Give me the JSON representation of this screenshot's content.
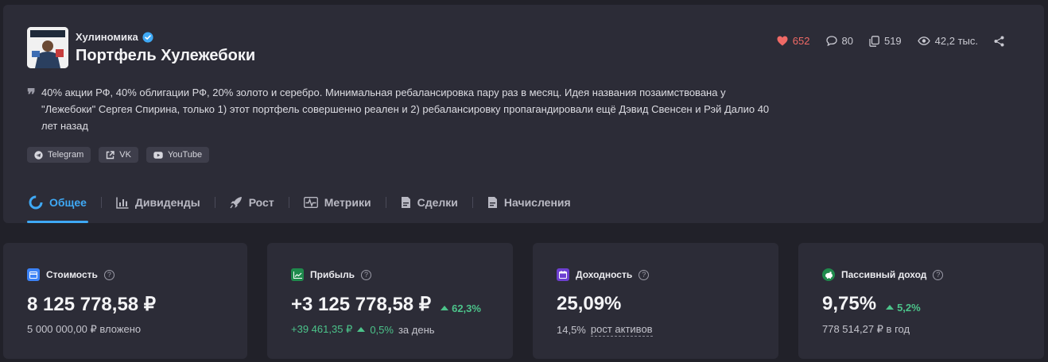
{
  "header": {
    "author": "Хулиномика",
    "title": "Портфель Хулежебоки",
    "stats": {
      "likes": "652",
      "comments": "80",
      "copies": "519",
      "views": "42,2 тыс."
    },
    "description": "40% акции РФ, 40% облигации РФ, 20% золото и серебро. Минимальная ребалансировка пару раз в месяц. Идея названия позаимствована у \"Лежебоки\" Сергея Спирина, только 1) этот портфель совершенно реален и 2) ребалансировку пропагандировали ещё Дэвид Свенсен и Рэй Далио 40 лет назад",
    "links": [
      {
        "label": "Telegram",
        "icon": "telegram-icon"
      },
      {
        "label": "VK",
        "icon": "external-link-icon"
      },
      {
        "label": "YouTube",
        "icon": "youtube-icon"
      }
    ]
  },
  "tabs": [
    {
      "label": "Общее",
      "icon": "pie-chart-icon",
      "active": true
    },
    {
      "label": "Дивиденды",
      "icon": "bar-chart-icon"
    },
    {
      "label": "Рост",
      "icon": "rocket-icon"
    },
    {
      "label": "Метрики",
      "icon": "pulse-icon"
    },
    {
      "label": "Сделки",
      "icon": "document-icon"
    },
    {
      "label": "Начисления",
      "icon": "document-icon"
    }
  ],
  "cards": {
    "value": {
      "title": "Стоимость",
      "amount": "8 125 778,58 ₽",
      "sub": "5 000 000,00 ₽ вложено",
      "icon_color": "#3b82f6"
    },
    "profit": {
      "title": "Прибыль",
      "amount": "+3 125 778,58 ₽",
      "change": "62,3%",
      "sub_amount": "+39 461,35 ₽",
      "sub_change": "0,5%",
      "sub_suffix": "за день",
      "icon_color": "#22c55e"
    },
    "yield": {
      "title": "Доходность",
      "amount": "25,09%",
      "sub_value": "14,5%",
      "sub_label": "рост активов",
      "icon_color": "#8b5cf6"
    },
    "passive": {
      "title": "Пассивный доход",
      "amount": "9,75%",
      "change": "5,2%",
      "sub": "778 514,27 ₽ в год",
      "icon_color": "#16a34a"
    }
  },
  "help_glyph": "?"
}
